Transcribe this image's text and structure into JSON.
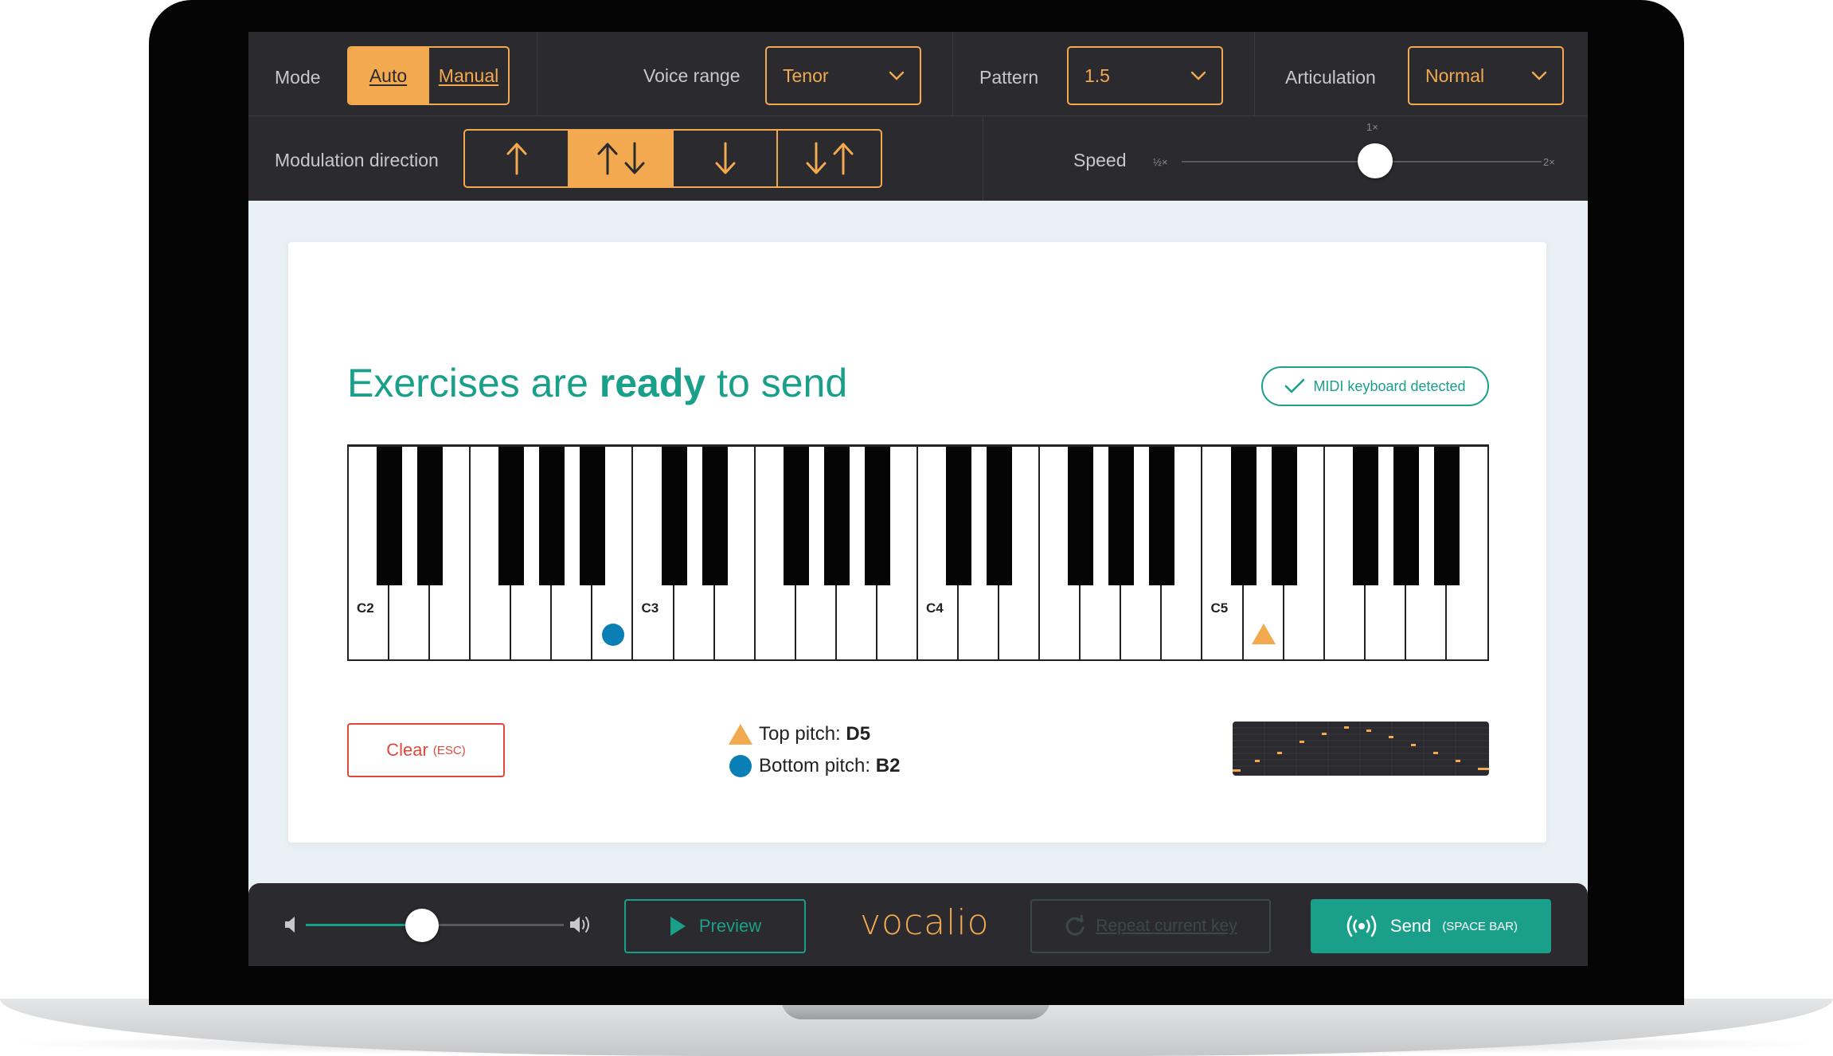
{
  "controls": {
    "mode": {
      "label": "Mode",
      "options": [
        "Auto",
        "Manual"
      ],
      "selected": "Auto"
    },
    "voice_range": {
      "label": "Voice range",
      "value": "Tenor"
    },
    "pattern": {
      "label": "Pattern",
      "value": "1.5"
    },
    "articulation": {
      "label": "Articulation",
      "value": "Normal"
    },
    "modulation": {
      "label": "Modulation direction",
      "options": [
        "up",
        "up-down",
        "down",
        "down-up"
      ],
      "selected": "up-down"
    },
    "speed": {
      "label": "Speed",
      "min_label": "½×",
      "mid_label": "1×",
      "max_label": "2×",
      "value": "1×"
    }
  },
  "card": {
    "headline_pre": "Exercises are ",
    "headline_bold": "ready",
    "headline_post": " to send",
    "midi_badge": "MIDI keyboard detected",
    "keyboard": {
      "labels": [
        "C2",
        "C3",
        "C4",
        "C5"
      ],
      "top_pitch": "D5",
      "bottom_pitch": "B2"
    },
    "clear": {
      "label": "Clear",
      "shortcut": "(ESC)"
    },
    "top_pitch_label": "Top pitch: ",
    "top_pitch_value": "D5",
    "bottom_pitch_label": "Bottom pitch: ",
    "bottom_pitch_value": "B2"
  },
  "bottom": {
    "volume_level": 0.45,
    "preview_label": "Preview",
    "logo": "vocalio",
    "repeat_label": "Repeat current key",
    "send_label": "Send",
    "send_shortcut": "(SPACE BAR)"
  },
  "colors": {
    "accent": "#f2a94f",
    "teal": "#1aa08a",
    "dark": "#2b2a2e",
    "blue": "#0a7fb5",
    "red": "#e0473b"
  }
}
